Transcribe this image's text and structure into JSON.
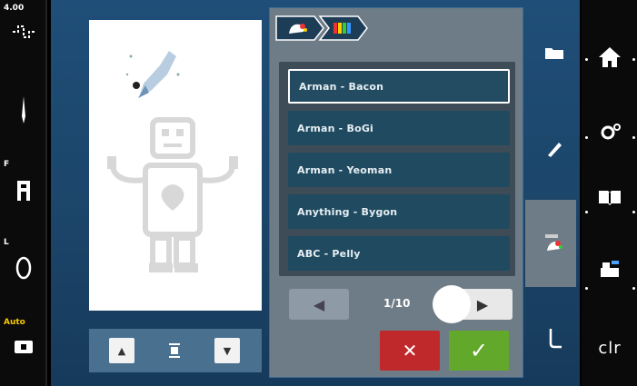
{
  "left_strip": {
    "stitch_width_value": "4.00",
    "needle_label": "",
    "presser_foot_label": "F",
    "bobbin_label": "L",
    "fabric_thickness_value": "Auto"
  },
  "breadcrumb": {
    "items": [
      "design-icon",
      "font-icon"
    ]
  },
  "font_list": {
    "items": [
      {
        "label": "Arman - Bacon",
        "selected": true
      },
      {
        "label": "Arman - BoGi",
        "selected": false
      },
      {
        "label": "Arman - Yeoman",
        "selected": false
      },
      {
        "label": "Anything - Bygon",
        "selected": false
      },
      {
        "label": "ABC - Pelly",
        "selected": false
      }
    ]
  },
  "pager": {
    "text": "1/10"
  },
  "right_strip": {
    "clr_label": "clr"
  },
  "colors": {
    "accent_blue": "#1f4e78",
    "cancel_red": "#c0292b",
    "ok_green": "#62a92b"
  }
}
